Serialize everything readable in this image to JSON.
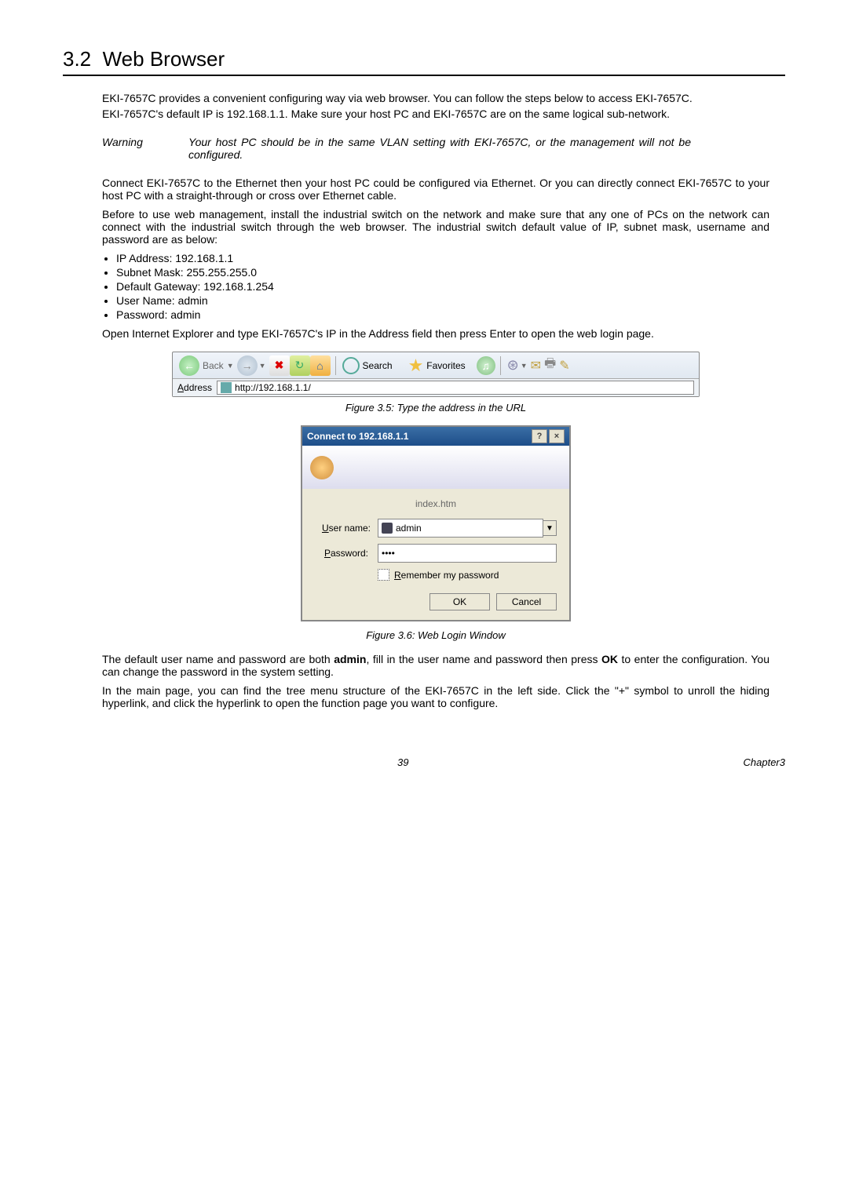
{
  "section": {
    "number": "3.2",
    "title": "Web Browser"
  },
  "intro1": "EKI-7657C provides a convenient configuring way via web browser. You can follow the steps below to access EKI-7657C.",
  "intro2": "EKI-7657C's default IP is 192.168.1.1. Make sure your host PC and EKI-7657C are on the same logical sub-network.",
  "warning": {
    "label": "Warning",
    "text": "Your host PC should be in the same VLAN setting with EKI-7657C, or the management will not be configured."
  },
  "para3": "Connect EKI-7657C to the Ethernet then your host PC could be configured via Ethernet. Or you can directly connect EKI-7657C to your host PC with a straight-through or cross over Ethernet cable.",
  "para4": "Before to use web management, install the industrial switch on the network and make sure that any one of PCs on the network can connect with the industrial switch through the web browser. The industrial switch default value of IP, subnet mask, username and password are as below:",
  "defaults": [
    "IP Address: 192.168.1.1",
    "Subnet Mask: 255.255.255.0",
    "Default Gateway: 192.168.1.254",
    "User Name: admin",
    "Password: admin"
  ],
  "para5": "Open Internet Explorer and type EKI-7657C's IP in the Address field then press Enter to open the web login page.",
  "ie": {
    "back": "Back",
    "search": "Search",
    "favorites": "Favorites",
    "address_label": "Address",
    "url": "http://192.168.1.1/"
  },
  "fig1": "Figure 3.5: Type the address in the URL",
  "login": {
    "title": "Connect to 192.168.1.1",
    "realm": "index.htm",
    "user_label": "User name:",
    "user_value": "admin",
    "pass_label": "Password:",
    "pass_value": "••••",
    "remember": "Remember my password",
    "ok": "OK",
    "cancel": "Cancel"
  },
  "fig2": "Figure 3.6: Web Login Window",
  "para6a": "The default user name and password are both ",
  "para6b": "admin",
  "para6c": ", fill in the user name and password then press ",
  "para6d": "OK",
  "para6e": " to enter the configuration. You can change the password in the system setting.",
  "para7": "In the main page, you can find the tree menu structure of the EKI-7657C in the left side. Click the \"+\" symbol to unroll the hiding hyperlink, and click the hyperlink to open the function page you want to configure.",
  "footer": {
    "page": "39",
    "chapter": "Chapter3"
  }
}
